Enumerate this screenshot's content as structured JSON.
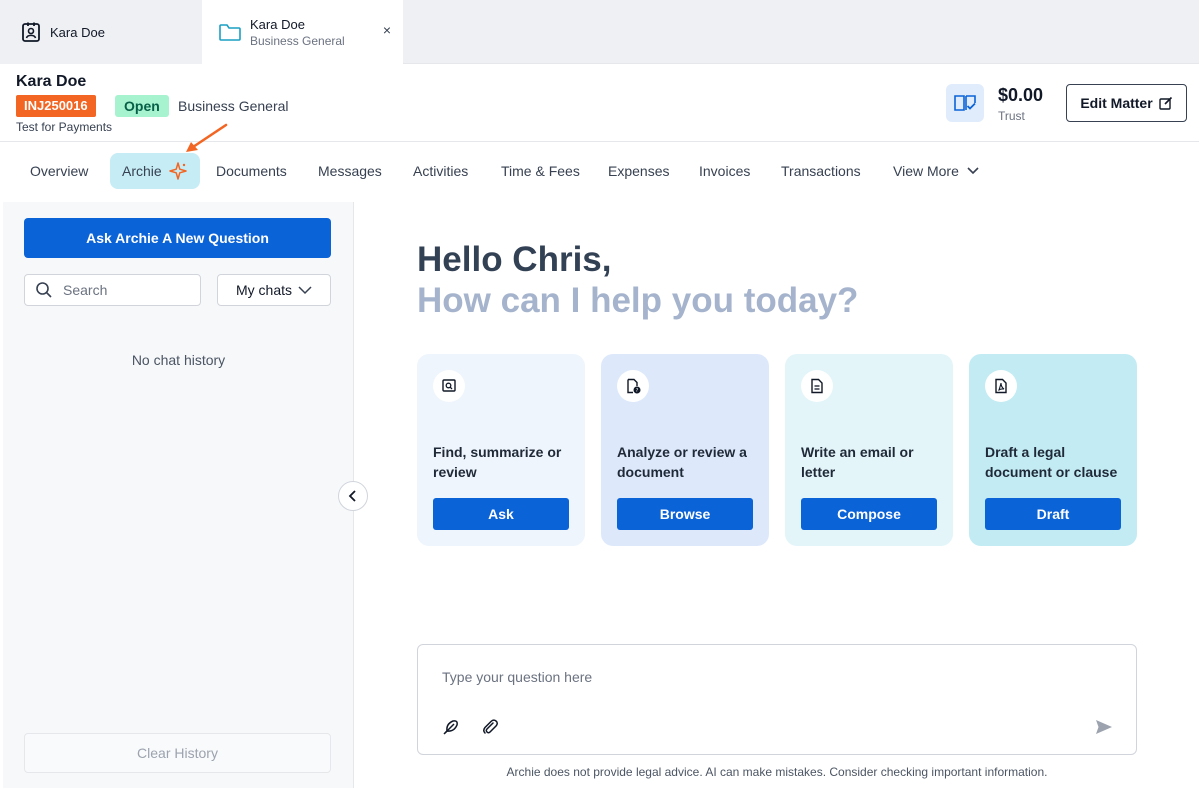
{
  "tabs": [
    {
      "title": "Kara Doe",
      "subtitle": "",
      "icon": "contact-icon"
    },
    {
      "title": "Kara Doe",
      "subtitle": "Business General",
      "icon": "folder-icon",
      "close": "×"
    }
  ],
  "header": {
    "client_name": "Kara Doe",
    "matter_number": "INJ250016",
    "status": "Open",
    "matter_type": "Business General",
    "description": "Test for Payments",
    "trust_amount": "$0.00",
    "trust_label": "Trust",
    "edit_label": "Edit Matter"
  },
  "nav": {
    "items": [
      "Overview",
      "Archie",
      "Documents",
      "Messages",
      "Activities",
      "Time & Fees",
      "Expenses",
      "Invoices",
      "Transactions",
      "View More"
    ],
    "active": "Archie"
  },
  "sidebar": {
    "ask_button": "Ask Archie A New Question",
    "search_placeholder": "Search",
    "filter": "My chats",
    "empty": "No chat history",
    "clear": "Clear History"
  },
  "main": {
    "greeting": "Hello Chris,",
    "subgreeting": "How can I help you today?",
    "cards": [
      {
        "text": "Find, summarize or review",
        "button": "Ask",
        "icon": "search-document-icon"
      },
      {
        "text": "Analyze or review a document",
        "button": "Browse",
        "icon": "document-question-icon"
      },
      {
        "text": "Write an email or letter",
        "button": "Compose",
        "icon": "document-lines-icon"
      },
      {
        "text": "Draft a legal document or clause",
        "button": "Draft",
        "icon": "document-pdf-icon"
      }
    ],
    "prompt_placeholder": "Type your question here",
    "disclaimer": "Archie does not provide legal advice. AI can make mistakes. Consider checking important information."
  },
  "colors": {
    "primary": "#0b63d8",
    "matter_badge": "#f26522",
    "open_badge": "#a7f3d0",
    "active_tab": "#c6ecf5"
  }
}
